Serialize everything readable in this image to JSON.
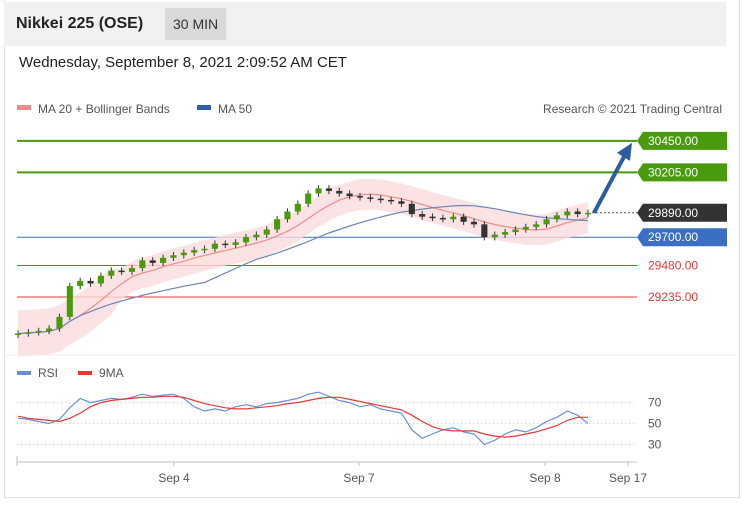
{
  "header": {
    "title": "Nikkei 225 (OSE)",
    "timeframe": "30 MIN",
    "datetime": "Wednesday, September 8, 2021 2:09:52 AM CET"
  },
  "legend": {
    "ma20_label": "MA 20 + Bollinger Bands",
    "ma50_label": "MA 50",
    "credit": "Research © 2021 Trading Central",
    "rsi_label": "RSI",
    "rsi_ma_label": "9MA"
  },
  "colors": {
    "green": "#4a9a0e",
    "blue": "#3b6fc4",
    "red": "#e53935",
    "ma20": "#f08c8c",
    "band": "#fbdcdc",
    "dark": "#333333",
    "arrow": "#2b5d9e"
  },
  "chart_data": [
    {
      "type": "candlestick",
      "x_labels": [
        "Sep 4",
        "Sep 7",
        "Sep 8",
        "Sep 17"
      ],
      "ylim": [
        28900,
        30550
      ],
      "last_price": 29890.0,
      "levels": [
        {
          "value": 30450.0,
          "label": "30450.00",
          "color": "green",
          "style": "badge"
        },
        {
          "value": 30205.0,
          "label": "30205.00",
          "color": "green",
          "style": "badge"
        },
        {
          "value": 29890.0,
          "label": "29890.00",
          "color": "dark",
          "style": "badge"
        },
        {
          "value": 29700.0,
          "label": "29700.00",
          "color": "blue",
          "style": "badge"
        },
        {
          "value": 29480.0,
          "label": "29480.00",
          "color": "red",
          "style": "text"
        },
        {
          "value": 29235.0,
          "label": "29235.00",
          "color": "red",
          "style": "text"
        }
      ],
      "close_series": [
        28950,
        28960,
        28970,
        28990,
        29080,
        29320,
        29360,
        29340,
        29400,
        29440,
        29430,
        29460,
        29520,
        29500,
        29540,
        29560,
        29580,
        29600,
        29610,
        29650,
        29640,
        29660,
        29700,
        29720,
        29760,
        29840,
        29900,
        29960,
        30040,
        30080,
        30060,
        30040,
        30020,
        30010,
        30000,
        29990,
        29980,
        29960,
        29880,
        29860,
        29850,
        29840,
        29860,
        29820,
        29800,
        29700,
        29720,
        29740,
        29760,
        29780,
        29800,
        29840,
        29870,
        29900,
        29880,
        29890
      ]
    },
    {
      "type": "line",
      "series": [
        {
          "name": "RSI",
          "values": [
            55,
            54,
            52,
            50,
            54,
            65,
            74,
            70,
            72,
            74,
            73,
            75,
            78,
            76,
            77,
            78,
            74,
            66,
            62,
            64,
            62,
            66,
            68,
            66,
            69,
            70,
            72,
            74,
            78,
            80,
            76,
            72,
            70,
            66,
            68,
            64,
            62,
            60,
            44,
            36,
            40,
            44,
            46,
            42,
            40,
            30,
            34,
            40,
            44,
            42,
            46,
            52,
            56,
            62,
            58,
            50
          ]
        },
        {
          "name": "9MA",
          "values": [
            57,
            55,
            54,
            53,
            52,
            55,
            60,
            66,
            70,
            72,
            73,
            74,
            75,
            75,
            76,
            76,
            75,
            72,
            69,
            67,
            65,
            64,
            64,
            65,
            66,
            67,
            69,
            70,
            72,
            74,
            75,
            75,
            73,
            71,
            69,
            67,
            65,
            63,
            58,
            52,
            47,
            44,
            43,
            43,
            43,
            40,
            38,
            37,
            38,
            40,
            42,
            45,
            48,
            53,
            56,
            56
          ]
        }
      ],
      "yticks": [
        70,
        50,
        30
      ],
      "ylim": [
        20,
        82
      ]
    }
  ]
}
